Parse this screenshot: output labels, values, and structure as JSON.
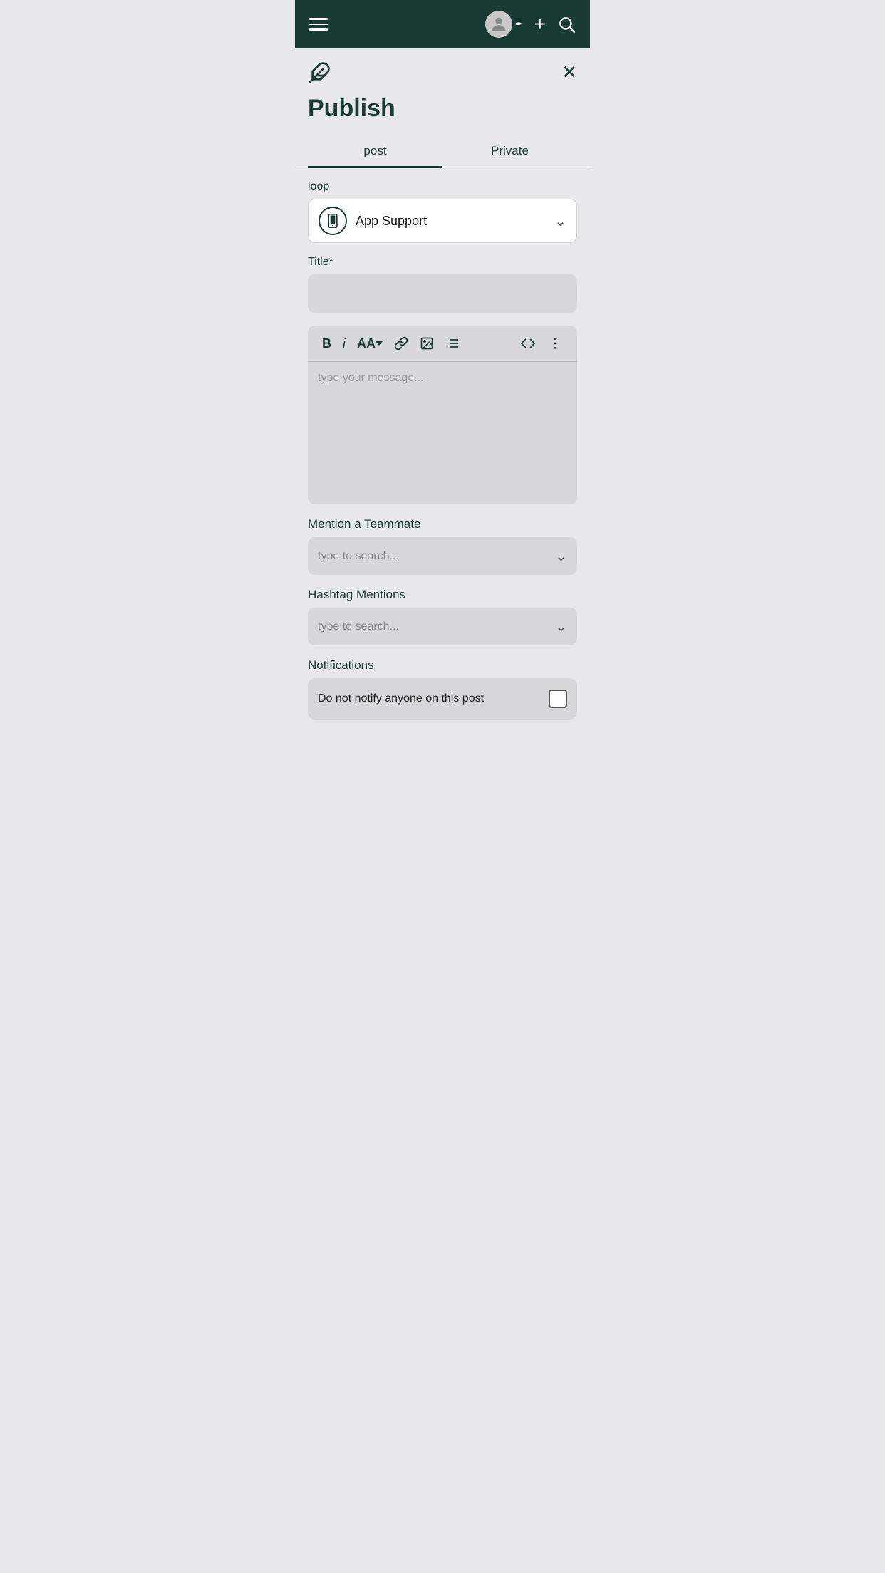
{
  "topNav": {
    "menuIcon": "hamburger-menu",
    "avatarIcon": "user-avatar",
    "caretIcon": "▾",
    "addIcon": "+",
    "searchIcon": "search"
  },
  "panel": {
    "featherIcon": "✒",
    "closeIcon": "✕",
    "title": "Publish",
    "tabs": [
      {
        "id": "post",
        "label": "post",
        "active": true
      },
      {
        "id": "private",
        "label": "Private",
        "active": false
      }
    ],
    "loopSection": {
      "label": "loop",
      "selected": {
        "name": "App Support",
        "iconType": "phone-icon"
      }
    },
    "titleSection": {
      "label": "Title*",
      "placeholder": ""
    },
    "editorSection": {
      "toolbar": {
        "bold": "B",
        "italic": "i",
        "fontSize": "AA",
        "link": "link",
        "image": "image",
        "list": "list",
        "code": "<>",
        "more": "⋮"
      },
      "placeholder": "type your message..."
    },
    "mentionSection": {
      "label": "Mention a Teammate",
      "placeholder": "type to search..."
    },
    "hashtagSection": {
      "label": "Hashtag Mentions",
      "placeholder": "type to search..."
    },
    "notificationsSection": {
      "label": "Notifications",
      "doNotNotifyText": "Do not notify anyone on this post"
    }
  }
}
